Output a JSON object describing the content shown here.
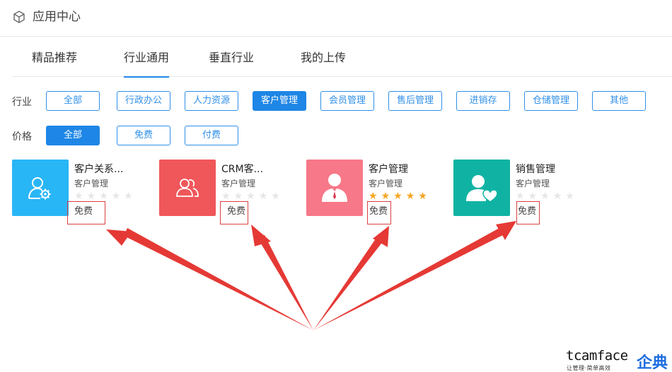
{
  "header": {
    "title": "应用中心",
    "icon": "cube-icon"
  },
  "tabs": [
    {
      "label": "精品推荐",
      "active": false
    },
    {
      "label": "行业通用",
      "active": true
    },
    {
      "label": "垂直行业",
      "active": false
    },
    {
      "label": "我的上传",
      "active": false
    }
  ],
  "filters": {
    "industry": {
      "label": "行业",
      "options": [
        "全部",
        "行政办公",
        "人力资源",
        "客户管理",
        "会员管理",
        "售后管理",
        "进销存",
        "仓储管理",
        "其他"
      ],
      "selected": "客户管理"
    },
    "price": {
      "label": "价格",
      "options": [
        "全部",
        "免费",
        "付费"
      ],
      "selected": "全部"
    }
  },
  "apps": [
    {
      "name": "客户关系...",
      "category": "客户管理",
      "rating": 0,
      "price": "免费",
      "color": "#29b6f6",
      "icon": "user-gear-icon"
    },
    {
      "name": "CRM客...",
      "category": "客户管理",
      "rating": 0,
      "price": "免费",
      "color": "#f0575a",
      "icon": "users-icon"
    },
    {
      "name": "客户管理",
      "category": "客户管理",
      "rating": 5,
      "price": "免费",
      "color": "#f77888",
      "icon": "businessman-icon"
    },
    {
      "name": "销售管理",
      "category": "客户管理",
      "rating": 0,
      "price": "免费",
      "color": "#10b3a3",
      "icon": "user-heart-icon"
    }
  ],
  "colors": {
    "accent": "#1e86e6",
    "annotation": "#e53935",
    "star": "#f5a623"
  },
  "brand": {
    "name_en": "tcamface",
    "name_zh": "企典",
    "slogan": "让管理·简单高效"
  }
}
